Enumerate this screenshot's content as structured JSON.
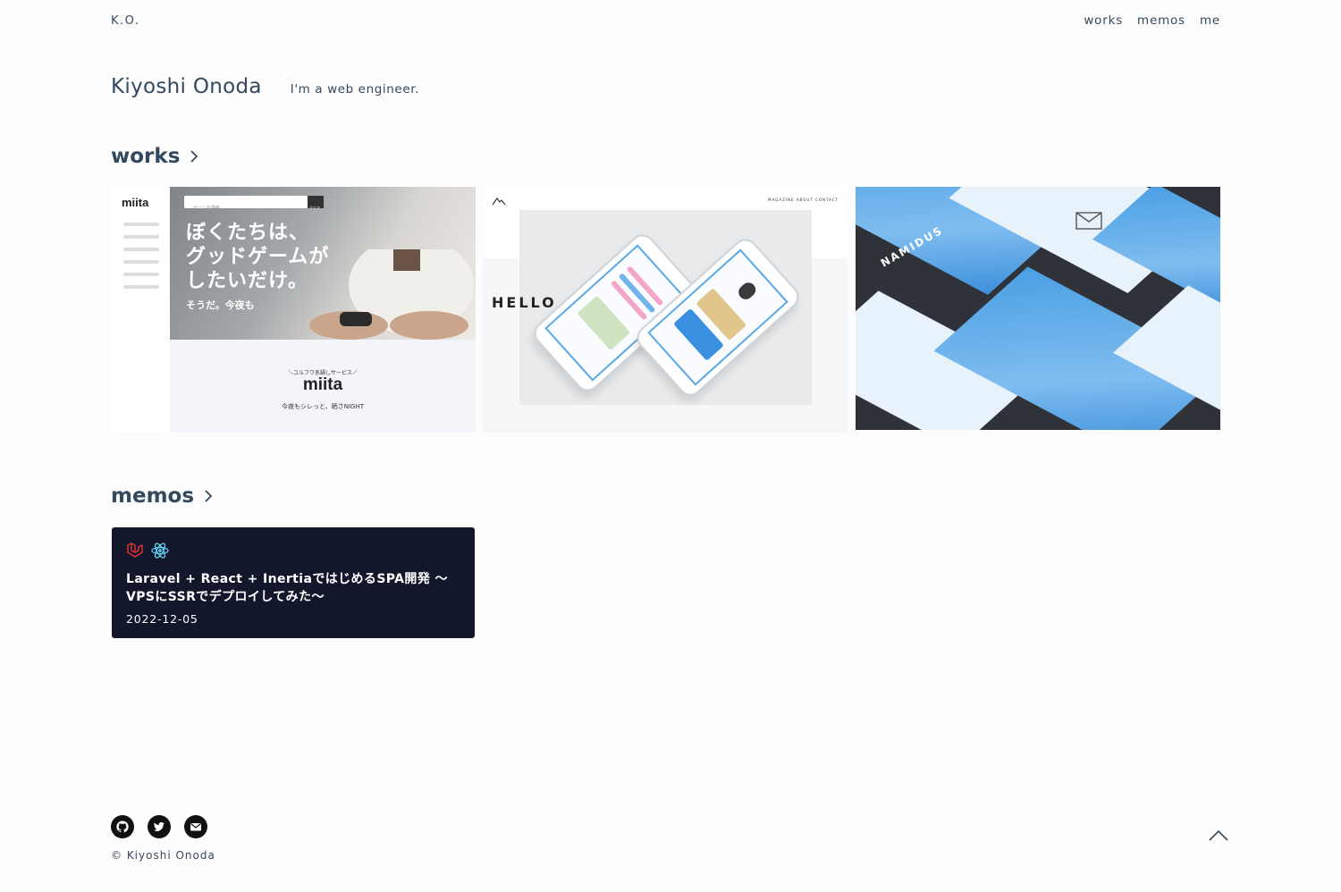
{
  "header": {
    "brand": "K.O.",
    "nav": [
      "works",
      "memos",
      "me"
    ]
  },
  "hero": {
    "name": "Kiyoshi Onoda",
    "tagline": "I'm a web engineer."
  },
  "sections": {
    "works_title": "works",
    "memos_title": "memos"
  },
  "works": {
    "thumb1": {
      "logo": "miita",
      "search_placeholder": "ゲームを検索",
      "search_button": "クリア",
      "headline": [
        "ぼくたちは、",
        "グッドゲームが",
        "したいだけ。"
      ],
      "subline": "そうだ。今夜も",
      "lower_small": "＼ユルフワ系鍋しサービス／",
      "lower_logo": "miita",
      "lower_tag": "今夜もシレっと、晒さNIGHT"
    },
    "thumb2": {
      "heading": "HELLO",
      "nav": "MAGAZINE   ABOUT   CONTACT"
    },
    "thumb3": {
      "watermark": "NAMIDUS"
    }
  },
  "memos": [
    {
      "icons": [
        "laravel-icon",
        "react-icon"
      ],
      "title": "Laravel + React + InertiaではじめるSPA開発 〜VPSにSSRでデプロイしてみた〜",
      "date": "2022-12-05"
    }
  ],
  "footer": {
    "icons": [
      "github-icon",
      "twitter-icon",
      "mail-icon"
    ],
    "copyright": "© Kiyoshi Onoda"
  },
  "colors": {
    "text": "#34495e",
    "memo_card_bg": "#12172b",
    "laravel": "#e3342f",
    "react": "#61dafb"
  }
}
